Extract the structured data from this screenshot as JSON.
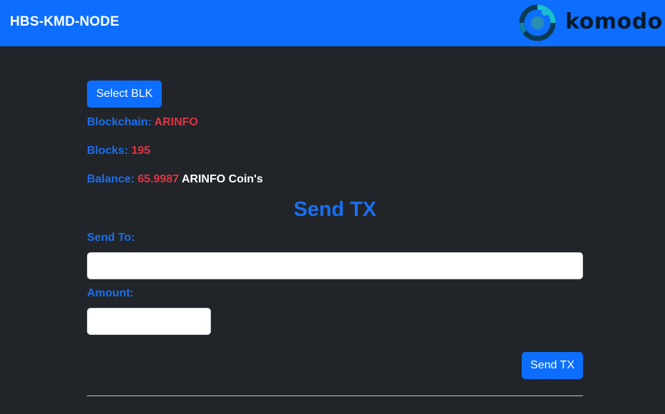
{
  "navbar": {
    "brand": "HBS-KMD-NODE",
    "logo_text": "komodo",
    "logo_icon": "komodo-logo-icon"
  },
  "main": {
    "select_button": "Select BLK",
    "blockchain": {
      "label": "Blockchain:",
      "value": "ARINFO"
    },
    "blocks": {
      "label": "Blocks:",
      "value": "195"
    },
    "balance": {
      "label": "Balance:",
      "value": "65.9987",
      "unit": "ARINFO Coin's"
    },
    "send_heading": "Send TX",
    "send_to": {
      "label": "Send To:",
      "value": "",
      "placeholder": ""
    },
    "amount": {
      "label": "Amount:",
      "value": "",
      "placeholder": ""
    },
    "send_button": "Send TX"
  },
  "colors": {
    "navbar": "#0d6efd",
    "background": "#212529",
    "label_blue": "#1a6ff0",
    "value_red": "#dc3545"
  }
}
